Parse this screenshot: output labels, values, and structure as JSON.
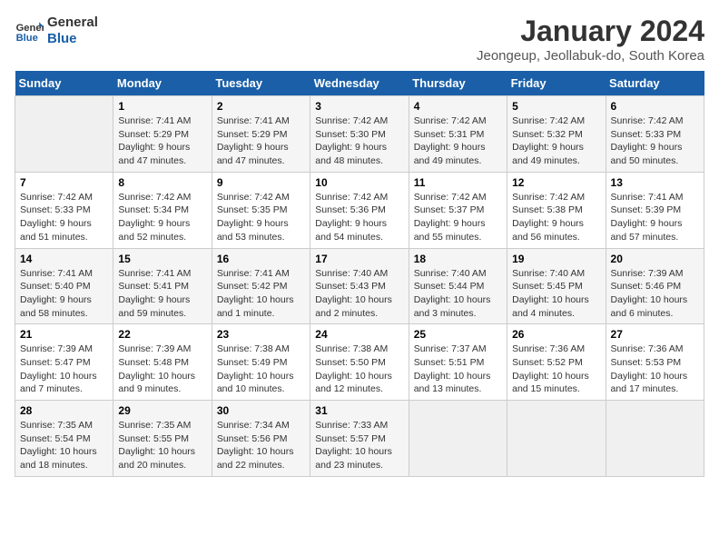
{
  "logo": {
    "text_general": "General",
    "text_blue": "Blue"
  },
  "title": "January 2024",
  "subtitle": "Jeongeup, Jeollabuk-do, South Korea",
  "headers": [
    "Sunday",
    "Monday",
    "Tuesday",
    "Wednesday",
    "Thursday",
    "Friday",
    "Saturday"
  ],
  "weeks": [
    [
      {
        "day": "",
        "sunrise": "",
        "sunset": "",
        "daylight": ""
      },
      {
        "day": "1",
        "sunrise": "Sunrise: 7:41 AM",
        "sunset": "Sunset: 5:29 PM",
        "daylight": "Daylight: 9 hours and 47 minutes."
      },
      {
        "day": "2",
        "sunrise": "Sunrise: 7:41 AM",
        "sunset": "Sunset: 5:29 PM",
        "daylight": "Daylight: 9 hours and 47 minutes."
      },
      {
        "day": "3",
        "sunrise": "Sunrise: 7:42 AM",
        "sunset": "Sunset: 5:30 PM",
        "daylight": "Daylight: 9 hours and 48 minutes."
      },
      {
        "day": "4",
        "sunrise": "Sunrise: 7:42 AM",
        "sunset": "Sunset: 5:31 PM",
        "daylight": "Daylight: 9 hours and 49 minutes."
      },
      {
        "day": "5",
        "sunrise": "Sunrise: 7:42 AM",
        "sunset": "Sunset: 5:32 PM",
        "daylight": "Daylight: 9 hours and 49 minutes."
      },
      {
        "day": "6",
        "sunrise": "Sunrise: 7:42 AM",
        "sunset": "Sunset: 5:33 PM",
        "daylight": "Daylight: 9 hours and 50 minutes."
      }
    ],
    [
      {
        "day": "7",
        "sunrise": "Sunrise: 7:42 AM",
        "sunset": "Sunset: 5:33 PM",
        "daylight": "Daylight: 9 hours and 51 minutes."
      },
      {
        "day": "8",
        "sunrise": "Sunrise: 7:42 AM",
        "sunset": "Sunset: 5:34 PM",
        "daylight": "Daylight: 9 hours and 52 minutes."
      },
      {
        "day": "9",
        "sunrise": "Sunrise: 7:42 AM",
        "sunset": "Sunset: 5:35 PM",
        "daylight": "Daylight: 9 hours and 53 minutes."
      },
      {
        "day": "10",
        "sunrise": "Sunrise: 7:42 AM",
        "sunset": "Sunset: 5:36 PM",
        "daylight": "Daylight: 9 hours and 54 minutes."
      },
      {
        "day": "11",
        "sunrise": "Sunrise: 7:42 AM",
        "sunset": "Sunset: 5:37 PM",
        "daylight": "Daylight: 9 hours and 55 minutes."
      },
      {
        "day": "12",
        "sunrise": "Sunrise: 7:42 AM",
        "sunset": "Sunset: 5:38 PM",
        "daylight": "Daylight: 9 hours and 56 minutes."
      },
      {
        "day": "13",
        "sunrise": "Sunrise: 7:41 AM",
        "sunset": "Sunset: 5:39 PM",
        "daylight": "Daylight: 9 hours and 57 minutes."
      }
    ],
    [
      {
        "day": "14",
        "sunrise": "Sunrise: 7:41 AM",
        "sunset": "Sunset: 5:40 PM",
        "daylight": "Daylight: 9 hours and 58 minutes."
      },
      {
        "day": "15",
        "sunrise": "Sunrise: 7:41 AM",
        "sunset": "Sunset: 5:41 PM",
        "daylight": "Daylight: 9 hours and 59 minutes."
      },
      {
        "day": "16",
        "sunrise": "Sunrise: 7:41 AM",
        "sunset": "Sunset: 5:42 PM",
        "daylight": "Daylight: 10 hours and 1 minute."
      },
      {
        "day": "17",
        "sunrise": "Sunrise: 7:40 AM",
        "sunset": "Sunset: 5:43 PM",
        "daylight": "Daylight: 10 hours and 2 minutes."
      },
      {
        "day": "18",
        "sunrise": "Sunrise: 7:40 AM",
        "sunset": "Sunset: 5:44 PM",
        "daylight": "Daylight: 10 hours and 3 minutes."
      },
      {
        "day": "19",
        "sunrise": "Sunrise: 7:40 AM",
        "sunset": "Sunset: 5:45 PM",
        "daylight": "Daylight: 10 hours and 4 minutes."
      },
      {
        "day": "20",
        "sunrise": "Sunrise: 7:39 AM",
        "sunset": "Sunset: 5:46 PM",
        "daylight": "Daylight: 10 hours and 6 minutes."
      }
    ],
    [
      {
        "day": "21",
        "sunrise": "Sunrise: 7:39 AM",
        "sunset": "Sunset: 5:47 PM",
        "daylight": "Daylight: 10 hours and 7 minutes."
      },
      {
        "day": "22",
        "sunrise": "Sunrise: 7:39 AM",
        "sunset": "Sunset: 5:48 PM",
        "daylight": "Daylight: 10 hours and 9 minutes."
      },
      {
        "day": "23",
        "sunrise": "Sunrise: 7:38 AM",
        "sunset": "Sunset: 5:49 PM",
        "daylight": "Daylight: 10 hours and 10 minutes."
      },
      {
        "day": "24",
        "sunrise": "Sunrise: 7:38 AM",
        "sunset": "Sunset: 5:50 PM",
        "daylight": "Daylight: 10 hours and 12 minutes."
      },
      {
        "day": "25",
        "sunrise": "Sunrise: 7:37 AM",
        "sunset": "Sunset: 5:51 PM",
        "daylight": "Daylight: 10 hours and 13 minutes."
      },
      {
        "day": "26",
        "sunrise": "Sunrise: 7:36 AM",
        "sunset": "Sunset: 5:52 PM",
        "daylight": "Daylight: 10 hours and 15 minutes."
      },
      {
        "day": "27",
        "sunrise": "Sunrise: 7:36 AM",
        "sunset": "Sunset: 5:53 PM",
        "daylight": "Daylight: 10 hours and 17 minutes."
      }
    ],
    [
      {
        "day": "28",
        "sunrise": "Sunrise: 7:35 AM",
        "sunset": "Sunset: 5:54 PM",
        "daylight": "Daylight: 10 hours and 18 minutes."
      },
      {
        "day": "29",
        "sunrise": "Sunrise: 7:35 AM",
        "sunset": "Sunset: 5:55 PM",
        "daylight": "Daylight: 10 hours and 20 minutes."
      },
      {
        "day": "30",
        "sunrise": "Sunrise: 7:34 AM",
        "sunset": "Sunset: 5:56 PM",
        "daylight": "Daylight: 10 hours and 22 minutes."
      },
      {
        "day": "31",
        "sunrise": "Sunrise: 7:33 AM",
        "sunset": "Sunset: 5:57 PM",
        "daylight": "Daylight: 10 hours and 23 minutes."
      },
      {
        "day": "",
        "sunrise": "",
        "sunset": "",
        "daylight": ""
      },
      {
        "day": "",
        "sunrise": "",
        "sunset": "",
        "daylight": ""
      },
      {
        "day": "",
        "sunrise": "",
        "sunset": "",
        "daylight": ""
      }
    ]
  ]
}
